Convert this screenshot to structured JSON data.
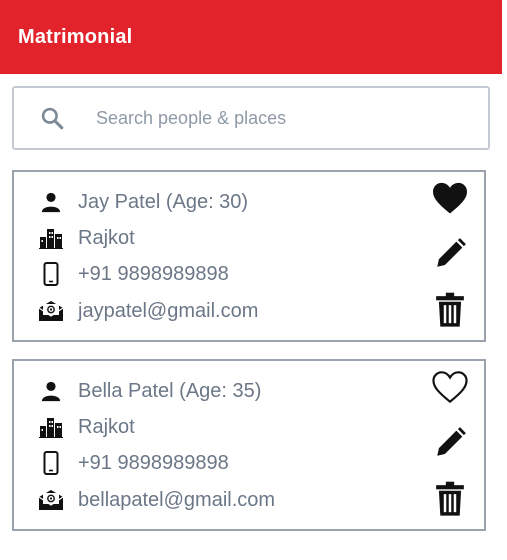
{
  "app": {
    "title": "Matrimonial",
    "accent_color": "#e3232b"
  },
  "search": {
    "placeholder": "Search people & places",
    "value": "",
    "icon": "search-icon"
  },
  "profiles": [
    {
      "name_line": "Jay Patel (Age: 30)",
      "city": "Rajkot",
      "phone": "+91 9898989898",
      "email": "jaypatel@gmail.com",
      "favorite": true
    },
    {
      "name_line": "Bella Patel (Age: 35)",
      "city": "Rajkot",
      "phone": "+91 9898989898",
      "email": "bellapatel@gmail.com",
      "favorite": false
    }
  ],
  "icons": {
    "person": "person-icon",
    "city": "city-buildings-icon",
    "phone": "mobile-phone-icon",
    "email": "email-envelope-icon",
    "favorite": "heart-icon",
    "edit": "pencil-icon",
    "delete": "trash-icon"
  }
}
